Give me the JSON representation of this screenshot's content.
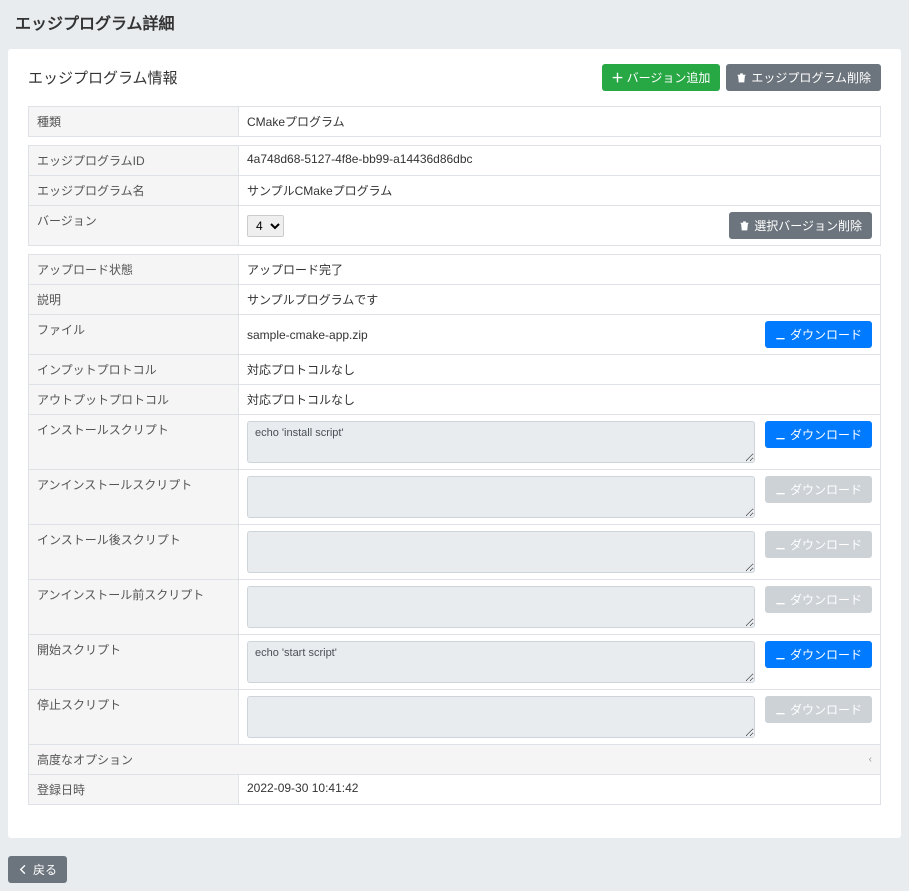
{
  "page_title": "エッジプログラム詳細",
  "section_title": "エッジプログラム情報",
  "actions": {
    "add_version": "バージョン追加",
    "delete_program": "エッジプログラム削除",
    "delete_version": "選択バージョン削除",
    "download": "ダウンロード",
    "back": "戻る"
  },
  "labels": {
    "type": "種類",
    "program_id": "エッジプログラムID",
    "program_name": "エッジプログラム名",
    "version": "バージョン",
    "upload_status": "アップロード状態",
    "description": "説明",
    "file": "ファイル",
    "input_protocol": "インプットプロトコル",
    "output_protocol": "アウトプットプロトコル",
    "install_script": "インストールスクリプト",
    "uninstall_script": "アンインストールスクリプト",
    "post_install_script": "インストール後スクリプト",
    "pre_uninstall_script": "アンインストール前スクリプト",
    "start_script": "開始スクリプト",
    "stop_script": "停止スクリプト",
    "advanced_options": "高度なオプション",
    "registered_at": "登録日時"
  },
  "values": {
    "type": "CMakeプログラム",
    "program_id": "4a748d68-5127-4f8e-bb99-a14436d86dbc",
    "program_name": "サンプルCMakeプログラム",
    "version_selected": "4",
    "upload_status": "アップロード完了",
    "description": "サンプルプログラムです",
    "file": "sample-cmake-app.zip",
    "input_protocol": "対応プロトコルなし",
    "output_protocol": "対応プロトコルなし",
    "install_script": "echo 'install script'",
    "uninstall_script": "",
    "post_install_script": "",
    "pre_uninstall_script": "",
    "start_script": "echo 'start script'",
    "stop_script": "",
    "registered_at": "2022-09-30 10:41:42"
  }
}
